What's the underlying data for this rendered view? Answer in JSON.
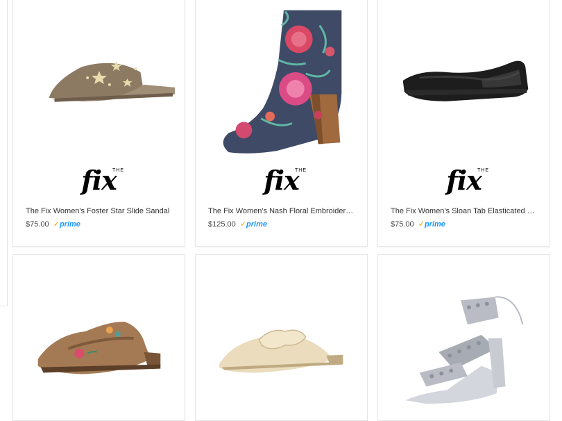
{
  "products": [
    {
      "title": "The Fix Women's Foster Star Slide Sandal",
      "price": "$75.00",
      "brand": "fix",
      "brand_small": "THE"
    },
    {
      "title": "The Fix Women's Nash Floral Embroider…",
      "price": "$125.00",
      "brand": "fix",
      "brand_small": "THE"
    },
    {
      "title": "The Fix Women's Sloan Tab Elasticated …",
      "price": "$75.00",
      "brand": "fix",
      "brand_small": "THE"
    },
    {
      "title": "",
      "price": ""
    },
    {
      "title": "",
      "price": ""
    },
    {
      "title": "",
      "price": ""
    }
  ],
  "prime": {
    "check": "✓",
    "label": "prime"
  },
  "colors": {
    "prime_blue": "#1a98ff",
    "prime_check": "#f7a600",
    "card_border": "#e6e6e6"
  },
  "icons": [
    "star-slide-sandal-image",
    "floral-ankle-boot-image",
    "black-ballet-flat-image",
    "embroidered-suede-mule-image",
    "bow-leather-mule-image",
    "silver-studded-sandal-image"
  ]
}
